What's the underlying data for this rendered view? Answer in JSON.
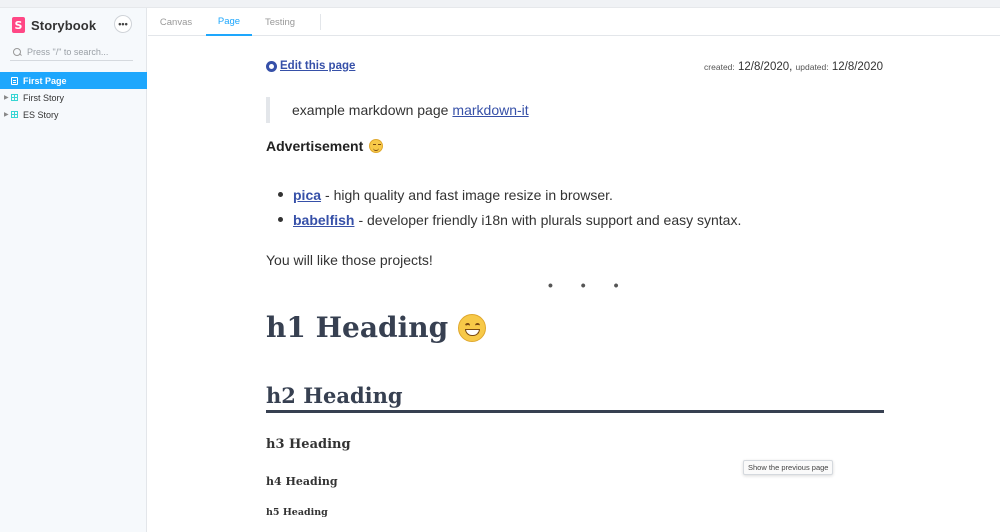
{
  "sidebar": {
    "brand": "Storybook",
    "brand_logo_letter": "S",
    "menu_label": "•••",
    "search_placeholder": "Press \"/\" to search...",
    "items": [
      {
        "label": "First Page",
        "icon": "document-icon",
        "active": true
      },
      {
        "label": "First Story",
        "icon": "component-icon",
        "active": false
      },
      {
        "label": "ES Story",
        "icon": "component-icon",
        "active": false
      }
    ]
  },
  "toolbar": {
    "tabs": [
      {
        "label": "Canvas",
        "active": false
      },
      {
        "label": "Page",
        "active": true
      },
      {
        "label": "Testing",
        "active": false
      }
    ]
  },
  "page": {
    "edit_link": "Edit this page",
    "created_label": "created:",
    "created_date": "12/8/2020",
    "updated_label": "updated:",
    "updated_date": "12/8/2020",
    "quote_text": "example markdown page",
    "quote_link": "markdown-it",
    "advertisement": "Advertisement",
    "list": [
      {
        "link": "pica",
        "text": "- high quality and fast image resize in browser."
      },
      {
        "link": "babelfish",
        "text": "- developer friendly i18n with plurals support and easy syntax."
      }
    ],
    "like_text": "You will like those projects!",
    "separator": "• • •",
    "h1": "h1 Heading",
    "h2": "h2 Heading",
    "h3": "h3 Heading",
    "h4": "h4 Heading",
    "h5": "h5 Heading"
  },
  "tooltip": "Show the previous page",
  "colors": {
    "accent": "#1ea7fd",
    "brand": "#ff4785",
    "link": "#3650a8",
    "heading": "#374051"
  }
}
